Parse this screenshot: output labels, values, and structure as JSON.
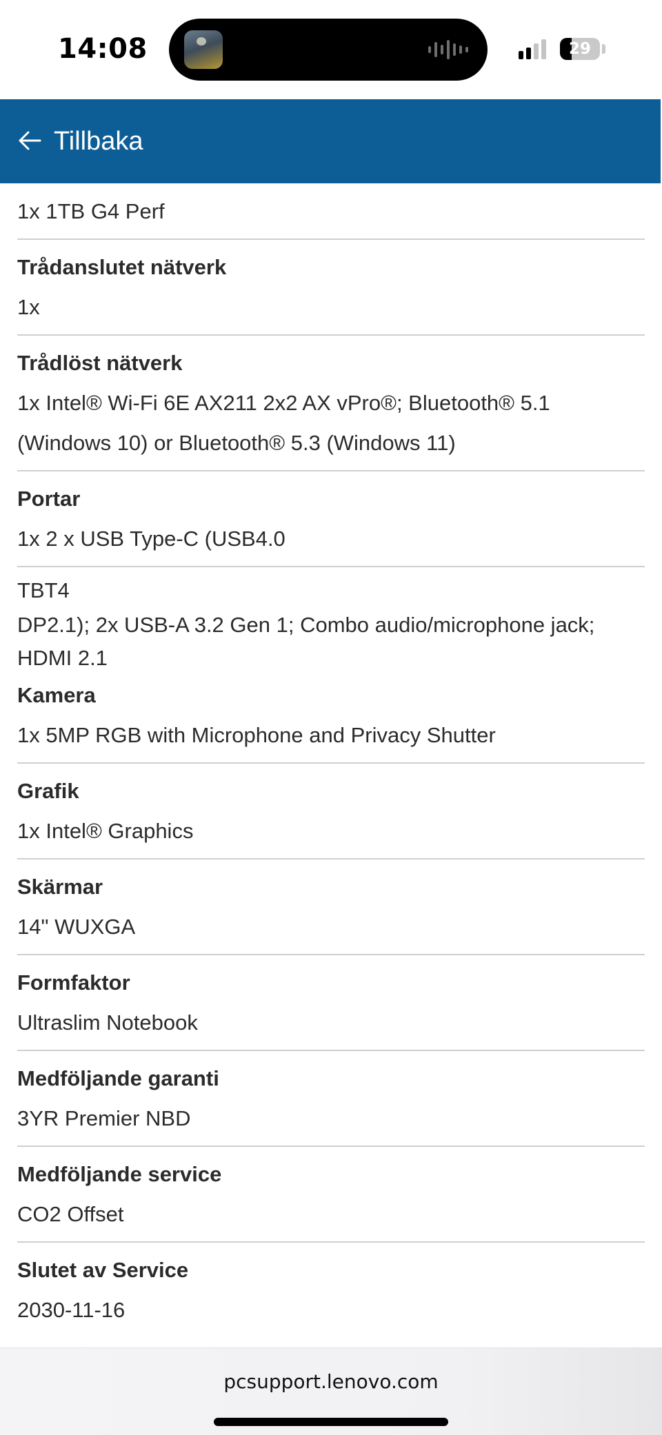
{
  "status_bar": {
    "time": "14:08",
    "battery_level": "29",
    "battery_percent": 29,
    "signal_bars_active": 2,
    "signal_bars_total": 4
  },
  "header": {
    "back_icon": "arrow-left-icon",
    "back_label": "Tillbaka",
    "background_color": "#0d5e96"
  },
  "specs": {
    "top_value": "1x 1TB G4 Perf",
    "wired_network": {
      "label": "Trådanslutet nätverk",
      "value": "1x"
    },
    "wireless_network": {
      "label": "Trådlöst nätverk",
      "value_line1": "1x Intel® Wi-Fi 6E AX211 2x2 AX vPro®; Bluetooth® 5.1",
      "value_line2": "(Windows 10) or Bluetooth® 5.3 (Windows 11)"
    },
    "ports": {
      "label": "Portar",
      "value": "1x 2 x USB Type-C (USB4.0",
      "extra_line1": "TBT4",
      "extra_line2": "DP2.1); 2x USB-A 3.2 Gen 1; Combo audio/microphone jack;",
      "extra_line3": "HDMI 2.1"
    },
    "camera": {
      "label": "Kamera",
      "value": "1x 5MP RGB with Microphone and Privacy Shutter"
    },
    "graphics": {
      "label": "Grafik",
      "value": "1x Intel® Graphics"
    },
    "displays": {
      "label": "Skärmar",
      "value": "14\" WUXGA"
    },
    "form_factor": {
      "label": "Formfaktor",
      "value": "Ultraslim Notebook"
    },
    "warranty": {
      "label": "Medföljande garanti",
      "value": "3YR Premier NBD"
    },
    "service": {
      "label": "Medföljande service",
      "value": "CO2 Offset"
    },
    "end_of_service": {
      "label": "Slutet av Service",
      "value": "2030-11-16"
    }
  },
  "footer": {
    "url": "pcsupport.lenovo.com"
  }
}
